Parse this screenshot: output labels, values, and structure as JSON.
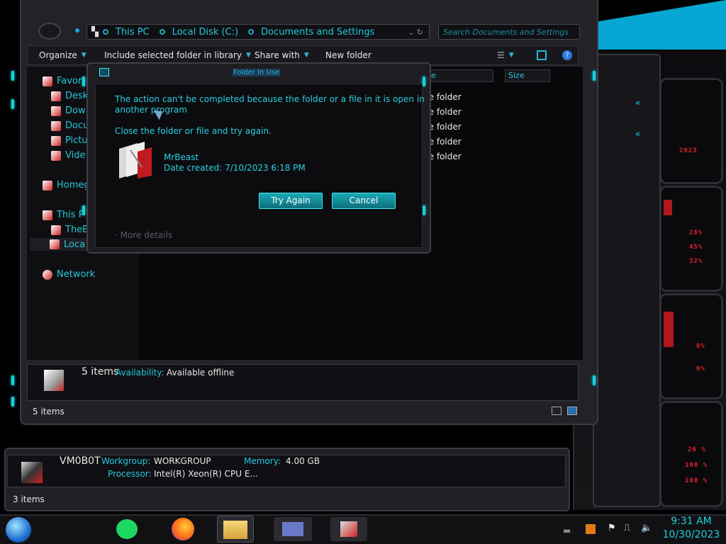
{
  "explorer": {
    "address_crumbs": [
      "This PC",
      "Local Disk (C:)",
      "Documents and Settings"
    ],
    "search_placeholder": "Search Documents and Settings",
    "toolbar": {
      "organize": "Organize",
      "include": "Include selected folder in library",
      "share": "Share with",
      "new_folder": "New folder"
    },
    "nav": {
      "favorites": "Favori",
      "desktop": "Desk",
      "downloads": "Dow",
      "documents": "Docu",
      "pictures": "Pictu",
      "videos": "Vide",
      "homegroup": "Homeg",
      "this_pc": "This P",
      "the": "TheB",
      "local": "Loca",
      "network": "Network"
    },
    "columns": {
      "type": "pe",
      "size": "Size"
    },
    "files": [
      "ile folder",
      "ile folder",
      "ile folder",
      "ile folder",
      "ile folder"
    ],
    "details": {
      "count": "5 items",
      "availability_label": "Availability:",
      "availability_value": "Available offline"
    },
    "status": "5 items"
  },
  "win2": {
    "name": "VM0B0T",
    "workgroup_label": "Workgroup:",
    "workgroup": "WORKGROUP",
    "memory_label": "Memory:",
    "memory": "4.00 GB",
    "processor_label": "Processor:",
    "processor": "Intel(R) Xeon(R) CPU E...",
    "status": "3 items"
  },
  "dialog": {
    "title": "Folder In Use",
    "message_line1": "The action can't be completed because the folder or a file in it is open in",
    "message_line2": "another program",
    "instruction": "Close the folder or file and try again.",
    "file_name": "MrBeast",
    "date_created": "Date created: 7/10/2023 6:18 PM",
    "try_again": "Try Again",
    "cancel": "Cancel",
    "more_details": "More details"
  },
  "gadget": {
    "year": "2023",
    "readouts": [
      "28%",
      "45%",
      "32%",
      "0%",
      "0%",
      "26 %",
      "100 %",
      "100 %"
    ]
  },
  "taskbar": {
    "time": "9:31 AM",
    "date": "10/30/2023"
  },
  "colors": {
    "accent": "#1fd0e0",
    "alert": "#e3232b"
  }
}
